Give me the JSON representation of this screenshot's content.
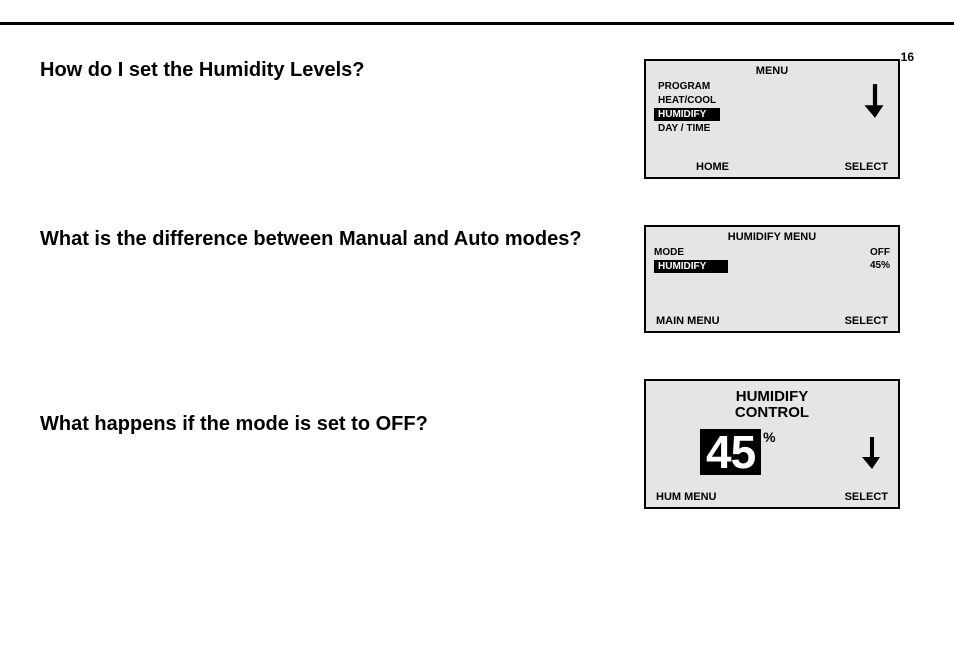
{
  "page_number": "16",
  "questions": {
    "q1": "How do I set the Humidity Levels?",
    "q2": "What is the difference between Manual and Auto modes?",
    "q3": "What happens if the mode is set to OFF?"
  },
  "screen1": {
    "title": "MENU",
    "items": [
      "PROGRAM",
      "HEAT/COOL",
      "HUMIDIFY",
      "DAY / TIME"
    ],
    "selected_index": 2,
    "footer_left": "HOME",
    "footer_right": "SELECT"
  },
  "screen2": {
    "title": "HUMIDIFY MENU",
    "row1_left": "MODE",
    "row1_right": "OFF",
    "selected_label": "HUMIDIFY",
    "row2_right": "45%",
    "footer_left": "MAIN MENU",
    "footer_right": "SELECT"
  },
  "screen3": {
    "title_line1": "HUMIDIFY",
    "title_line2": "CONTROL",
    "value": "45",
    "unit": "%",
    "footer_left": "HUM MENU",
    "footer_right": "SELECT"
  }
}
